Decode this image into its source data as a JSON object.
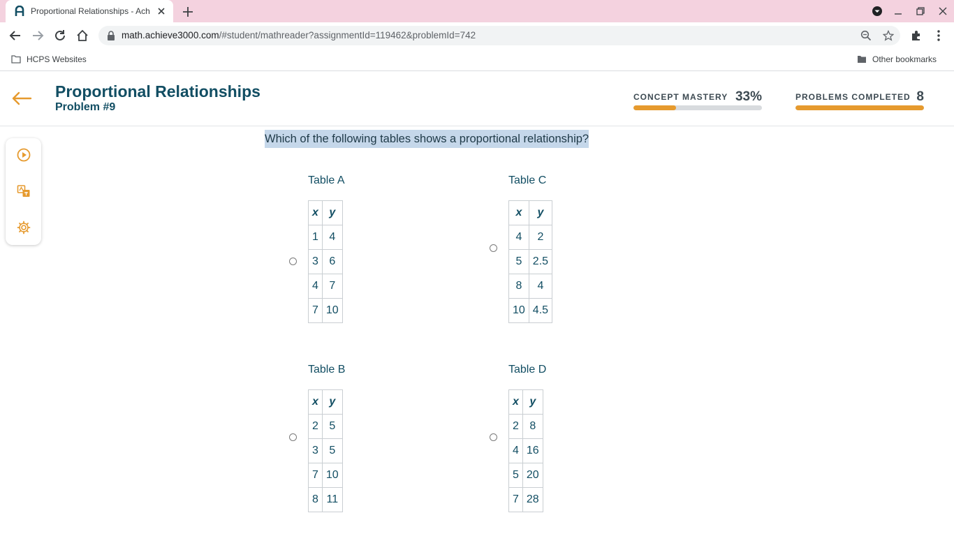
{
  "browser": {
    "tab_title": "Proportional Relationships - Ach",
    "url_host": "math.achieve3000.com",
    "url_rest": "/#student/mathreader?assignmentId=119462&problemId=742",
    "bookmarks": [
      "HCPS Websites",
      "Other bookmarks"
    ]
  },
  "header": {
    "title": "Proportional Relationships",
    "problem": "Problem #9",
    "concept_mastery_label": "CONCEPT MASTERY",
    "concept_mastery_value": "33%",
    "concept_mastery_fraction": 0.33,
    "problems_completed_label": "PROBLEMS COMPLETED",
    "problems_completed_value": "8",
    "problems_completed_fraction": 1.0
  },
  "tools": [
    "play-icon",
    "translate-icon",
    "gear-icon"
  ],
  "question": "Which of the following tables shows a proportional relationship?",
  "tables": {
    "a": {
      "label": "Table A",
      "header": [
        "x",
        "y"
      ],
      "rows": [
        [
          "1",
          "4"
        ],
        [
          "3",
          "6"
        ],
        [
          "4",
          "7"
        ],
        [
          "7",
          "10"
        ]
      ]
    },
    "c": {
      "label": "Table C",
      "header": [
        "x",
        "y"
      ],
      "rows": [
        [
          "4",
          "2"
        ],
        [
          "5",
          "2.5"
        ],
        [
          "8",
          "4"
        ],
        [
          "10",
          "4.5"
        ]
      ]
    },
    "b": {
      "label": "Table B",
      "header": [
        "x",
        "y"
      ],
      "rows": [
        [
          "2",
          "5"
        ],
        [
          "3",
          "5"
        ],
        [
          "7",
          "10"
        ],
        [
          "8",
          "11"
        ]
      ]
    },
    "d": {
      "label": "Table D",
      "header": [
        "x",
        "y"
      ],
      "rows": [
        [
          "2",
          "8"
        ],
        [
          "4",
          "16"
        ],
        [
          "5",
          "20"
        ],
        [
          "7",
          "28"
        ]
      ]
    }
  },
  "colors": {
    "brand": "#124e63",
    "accent": "#e69a2e",
    "highlight": "#c5d7ea",
    "tabbar": "#f4d2df"
  }
}
